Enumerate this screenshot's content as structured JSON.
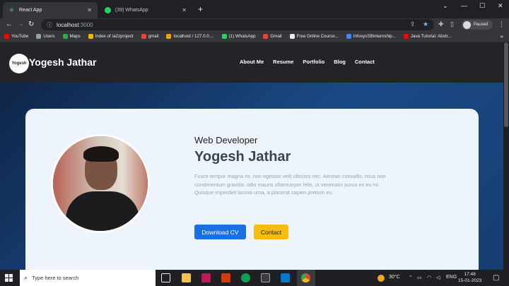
{
  "browser": {
    "tabs": [
      {
        "title": "React App",
        "active": true
      },
      {
        "title": "(39) WhatsApp",
        "active": false
      }
    ],
    "new_tab_label": "+",
    "window_controls": [
      "⌄",
      "—",
      "☐",
      "✕"
    ],
    "url": "localhost",
    "url_port": ":3000",
    "profile_label": "Paused",
    "bookmarks": [
      {
        "label": "YouTube",
        "color": "#ff0000"
      },
      {
        "label": "Users",
        "color": "#9aa0a6"
      },
      {
        "label": "Maps",
        "color": "#34a853"
      },
      {
        "label": "Index of /a2zproject",
        "color": "#f4b400"
      },
      {
        "label": "gmail",
        "color": "#ea4335"
      },
      {
        "label": "localhost / 127.0.0....",
        "color": "#f4a400"
      },
      {
        "label": "(1) WhatsApp",
        "color": "#25d366"
      },
      {
        "label": "Gmail",
        "color": "#ea4335"
      },
      {
        "label": "Free Online Course...",
        "color": "#e8eaed"
      },
      {
        "label": "InfosysSBInternship...",
        "color": "#4285f4"
      },
      {
        "label": "Java Tutorial: Abstr...",
        "color": "#ff0000"
      }
    ],
    "bookmarks_more": "»"
  },
  "site": {
    "logo_text": "Yogesh",
    "name": "Yogesh Jathar",
    "nav": [
      "About Me",
      "Resume",
      "Portfolio",
      "Blog",
      "Contact"
    ],
    "hero": {
      "role": "Web Developer",
      "name": "Yogesh Jathar",
      "bio": "Fusce tempor magna mi, non egestas velit ultricies nec. Aenean convallis, risus non condimentum gravida, odio mauris ullamcorper felis, ut venenatis purus ex eu mi. Quisque imperdiet lacinia urna, a placerat sapien pretium eu.",
      "download_cv": "Download CV",
      "contact": "Contact"
    }
  },
  "taskbar": {
    "search_placeholder": "Type here to search",
    "weather": "30°C",
    "language": "ENG",
    "time": "17:48",
    "date": "15-01-2023"
  },
  "colors": {
    "accent_blue": "#1a6fe3",
    "accent_yellow": "#f6bd10",
    "header_bg": "#222427"
  }
}
